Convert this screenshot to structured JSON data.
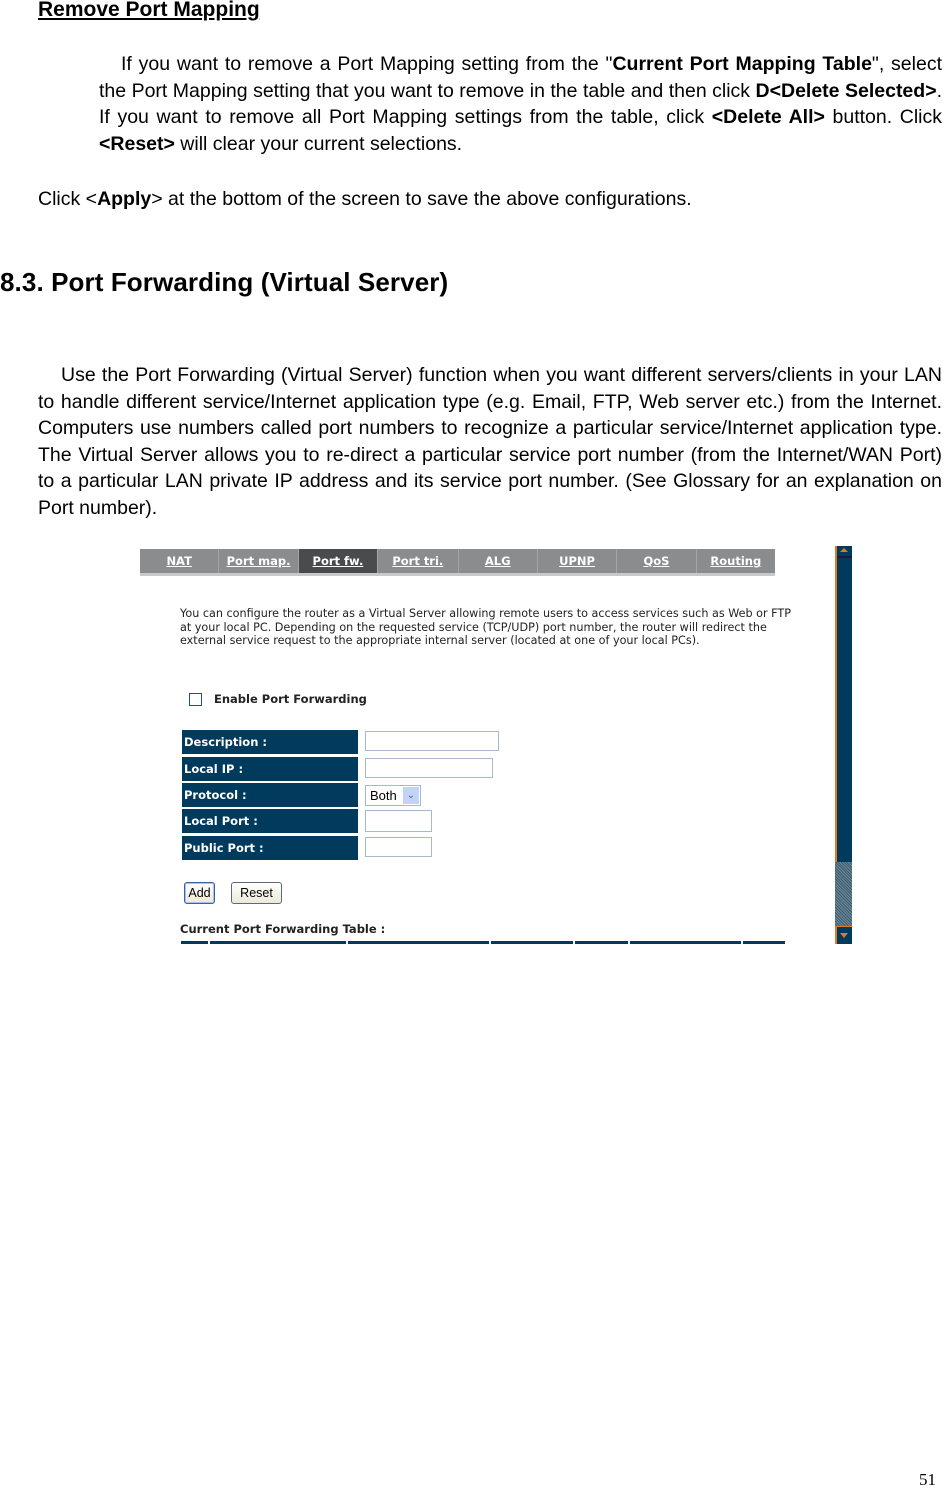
{
  "remove_section": {
    "heading": "Remove Port Mapping",
    "para1": {
      "t1": "If you want to remove a Port Mapping setting from the \"",
      "b1": "Current Port Mapping Table",
      "t2": "\", select the Port Mapping setting that you want to remove in the table and then click ",
      "b2": "D<Delete Selected>",
      "t3": ". If you want to remove all Port Mapping settings from the table, click ",
      "b3": "<Delete All>",
      "t4": " button. Click ",
      "b4": "<Reset>",
      "t5": " will clear your current selections."
    },
    "para2": {
      "t1": "Click <",
      "b1": "Apply",
      "t2": "> at the bottom of the screen to save the above configurations."
    }
  },
  "section": {
    "heading": "8.3. Port Forwarding (Virtual Server)",
    "body": "Use the Port Forwarding (Virtual Server) function when you want different servers/clients in your LAN to handle different service/Internet application type (e.g. Email, FTP, Web server etc.) from the Internet. Computers use numbers called port numbers to recognize a particular service/Internet application type. The Virtual Server allows you to re-direct a particular service port number (from the Internet/WAN Port) to a particular LAN private IP address and its service port number. (See Glossary for an explanation on Port number)."
  },
  "router_ui": {
    "tabs": [
      {
        "label": "NAT",
        "active": false
      },
      {
        "label": "Port map.",
        "active": false
      },
      {
        "label": "Port fw.",
        "active": true
      },
      {
        "label": "Port tri.",
        "active": false
      },
      {
        "label": "ALG",
        "active": false
      },
      {
        "label": "UPNP",
        "active": false
      },
      {
        "label": "QoS",
        "active": false
      },
      {
        "label": "Routing",
        "active": false
      }
    ],
    "description": "You can configure the router as a Virtual Server allowing remote users to access services such as Web or FTP at your local PC. Depending on the requested service (TCP/UDP) port number, the router will redirect the external service request to the appropriate internal server (located at one of your local PCs).",
    "enable_checkbox": {
      "label": "Enable Port Forwarding",
      "checked": false
    },
    "form": {
      "description_label": "Description :",
      "description_value": "",
      "local_ip_label": "Local IP :",
      "local_ip_value": "",
      "protocol_label": "Protocol :",
      "protocol_value": "Both",
      "local_port_label": "Local Port :",
      "local_port_value": "",
      "public_port_label": "Public Port :",
      "public_port_value": ""
    },
    "buttons": {
      "add": "Add",
      "reset": "Reset"
    },
    "table_title": "Current Port Forwarding Table :",
    "icons": {
      "dropdown": "chevron-down-icon",
      "scroll_up": "arrow-up-icon",
      "scroll_down": "arrow-down-icon"
    },
    "colors": {
      "label_bg": "#003a5d",
      "tab_bg": "#8a8c8e",
      "tab_active_bg": "#4a4b4d",
      "scroll_accent": "#e87722"
    }
  },
  "page_number": "51"
}
